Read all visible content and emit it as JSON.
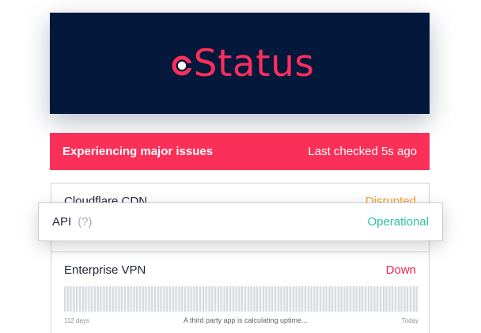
{
  "brand": {
    "name": "Status",
    "colors": {
      "header_bg": "#03183a",
      "accent": "#fb2e5c"
    },
    "icon": "status-ring-icon"
  },
  "banner": {
    "title": "Experiencing major issues",
    "last_checked": "Last checked 5s ago"
  },
  "services": [
    {
      "name": "Cloudflare CDN",
      "status": "Disrupted",
      "color": "#f0a22a"
    },
    {
      "name": "API",
      "help": "(?)",
      "status": "Operational",
      "color": "#27c3a3"
    },
    {
      "name": "Enterprise VPN",
      "status": "Down",
      "color": "#f0234e"
    }
  ],
  "uptime": {
    "start_label": "112 days",
    "message": "A third party app is calculating uptime...",
    "end_label": "Today"
  }
}
